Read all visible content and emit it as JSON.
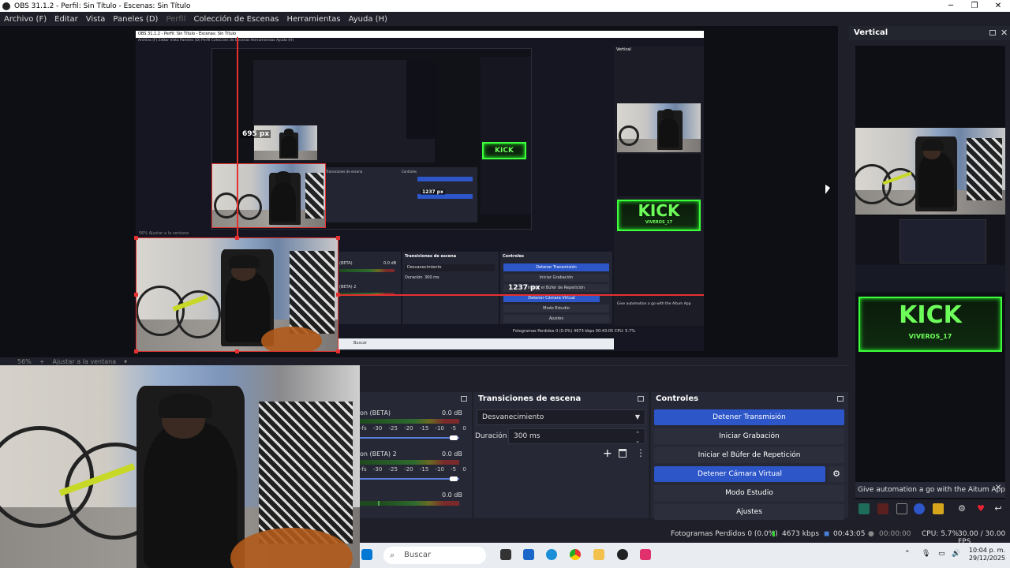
{
  "window": {
    "title": "OBS 31.1.2 - Perfil: Sin Título - Escenas: Sin Título",
    "controls": [
      "─",
      "❐",
      "✕"
    ]
  },
  "menu": {
    "items": [
      "Archivo (F)",
      "Editar",
      "Vista",
      "Paneles (D)",
      "Perfil",
      "Colección de Escenas",
      "Herramientas",
      "Ayuda (H)"
    ]
  },
  "preview": {
    "nested_title": "OBS 31.1.2 - Perfil: Sin Título - Escenas: Sin Título",
    "nested_menu": "Archivo (F)   Editar   Vista   Paneles (D)   Perfil   Colección de Escenas   Herramientas   Ayuda (H)",
    "label_695": "695 px",
    "label_1237": "1237 px",
    "label_1237_small": "1237 px",
    "nested_vertical": "Vertical",
    "nested_trans_title": "Transiciones de escena",
    "nested_controls_title": "Controles",
    "nested_fade": "Desvanecimiento",
    "nested_duration": "Duración",
    "nested_duration_val": "300 ms",
    "nested_btns": [
      "Detener Transmisión",
      "Iniciar Grabación",
      "Iniciar el Búfer de Repetición",
      "Detener Cámara Virtual",
      "Modo Estudio",
      "Ajustes"
    ],
    "nested_aitum": "Give automation a go with the Aitum App",
    "nested_status": "Fotogramas Perdidos 0 (0.0%)   4673 kbps   00:43:05   CPU: 5.7%",
    "nested_search": "Buscar",
    "nested_zoom": "56%   Ajustar a la ventana",
    "nested_beta1": "(BETA)",
    "nested_beta2": "(BETA) 2",
    "nested_db": "0.0 dB",
    "kick": "KICK",
    "kick_sub": "VIVEROS_17"
  },
  "zoombar": {
    "zoom": "56%",
    "plus": "+",
    "fit": "Ajustar a la ventana"
  },
  "mixer": {
    "rows": [
      {
        "name": "on (BETA)",
        "db": "0.0 dB",
        "scale": "-fs -30 -25 -20 -15 -10 -5 0"
      },
      {
        "name": "on (BETA) 2",
        "db": "0.0 dB",
        "scale": "-fs -30 -25 -20 -15 -10 -5 0"
      },
      {
        "db": "0.0 dB"
      }
    ]
  },
  "transitions": {
    "title": "Transiciones de escena",
    "selected": "Desvanecimiento",
    "duration_label": "Duración",
    "duration_value": "300 ms"
  },
  "controls": {
    "title": "Controles",
    "stop_stream": "Detener Transmisión",
    "start_rec": "Iniciar Grabación",
    "replay": "Iniciar el Búfer de Repetición",
    "stop_vcam": "Detener Cámara Virtual",
    "studio": "Modo Estudio",
    "settings": "Ajustes"
  },
  "status": {
    "dropped": "Fotogramas Perdidos 0 (0.0%)",
    "bitrate": "4673 kbps",
    "stream_time": "00:43:05",
    "rec_time": "00:00:00",
    "cpu": "CPU: 5.7%",
    "fps": "30.00 / 30.00 FPS"
  },
  "taskbar": {
    "search": "Buscar",
    "time": "10:04 p. m.",
    "date": "29/12/2025"
  },
  "vertical": {
    "title": "Vertical",
    "aitum": "Give automation a go with the Aitum App",
    "kick": "KICK",
    "kick_sub": "VIVEROS_17"
  },
  "colors": {
    "accent_blue": "#2d56c9",
    "selection_red": "#e53030",
    "kick_green": "#3cff3c"
  }
}
